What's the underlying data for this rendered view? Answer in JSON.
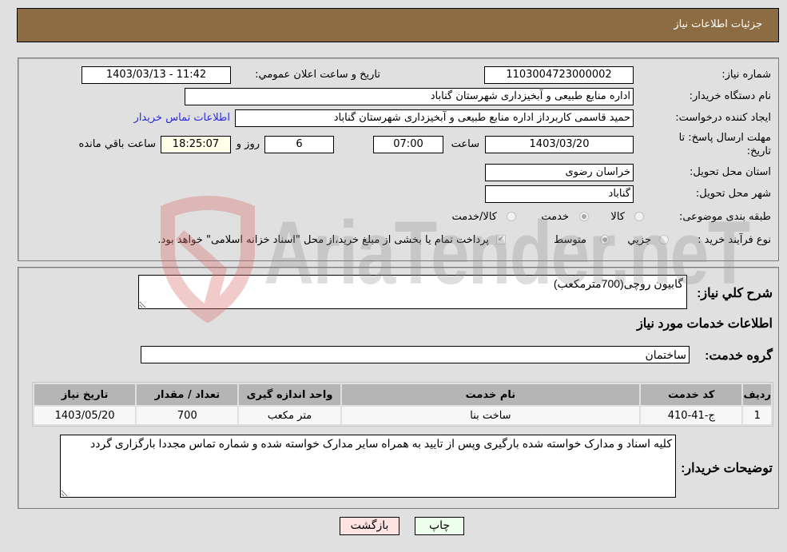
{
  "header": {
    "title": "جزئیات اطلاعات نیاز"
  },
  "form": {
    "need_number": {
      "label": "شماره نیاز:",
      "value": "1103004723000002"
    },
    "announce_datetime": {
      "label": "تاریخ و ساعت اعلان عمومي:",
      "value": "1403/03/13 - 11:42"
    },
    "buyer_org": {
      "label": "نام دستگاه خریدار:",
      "value": "اداره منابع طبیعی و آبخیزداری شهرستان گناباد"
    },
    "creator": {
      "label": "ایجاد کننده درخواست:",
      "value": "حمید قاسمی  کاربرداز اداره منابع طبیعی و آبخیزداری شهرستان گناباد",
      "contact_link": "اطلاعات تماس خریدار"
    },
    "deadline": {
      "label_line1": "مهلت ارسال پاسخ: تا",
      "label_line2": "تاریخ:",
      "date": "1403/03/20",
      "time_label": "ساعت",
      "time": "07:00",
      "days": "6",
      "days_label": "روز و",
      "remaining": "18:25:07",
      "remaining_label": "ساعت باقي مانده"
    },
    "province": {
      "label": "استان محل تحویل:",
      "value": "خراسان رضوی"
    },
    "city": {
      "label": "شهر محل تحویل:",
      "value": "گناباد"
    },
    "category": {
      "label": "طبقه بندی موضوعی:",
      "options": [
        {
          "label": "کالا",
          "selected": false
        },
        {
          "label": "خدمت",
          "selected": true
        },
        {
          "label": "کالا/خدمت",
          "selected": false
        }
      ]
    },
    "process": {
      "label": "نوع فرآیند خرید :",
      "options": [
        {
          "label": "جزيي",
          "selected": false
        },
        {
          "label": "متوسط",
          "selected": true
        }
      ],
      "treasury_checked": true,
      "treasury_text": "پرداخت تمام یا بخشی از مبلغ خرید،از محل \"اسناد خزانه اسلامی\" خواهد بود."
    }
  },
  "details": {
    "description_label": "شرح کلي نیاز:",
    "description": "گابیون روچی(700مترمکعب)",
    "services_heading": "اطلاعات خدمات مورد نیاز",
    "service_group_label": "گروه خدمت:",
    "service_group": "ساختمان",
    "table": {
      "headers": [
        "ردیف",
        "کد خدمت",
        "نام خدمت",
        "واحد اندازه گیری",
        "تعداد / مقدار",
        "تاریخ نیاز"
      ],
      "rows": [
        [
          "1",
          "ج-41-410",
          "ساخت بنا",
          "متر مکعب",
          "700",
          "1403/05/20"
        ]
      ]
    },
    "buyer_notes_label": "توضیحات خریدار:",
    "buyer_notes": "کلیه اسناد و مدارک خواسته شده بارگیری وپس از تایید به همراه سایر مدارک خواسته شده و شماره تماس مجددا بارگزاری گردد"
  },
  "buttons": {
    "print": "چاپ",
    "back": "بازگشت"
  },
  "watermark": {
    "text": "AriaTender.neT",
    "logo_color": "#e8a0a0"
  }
}
